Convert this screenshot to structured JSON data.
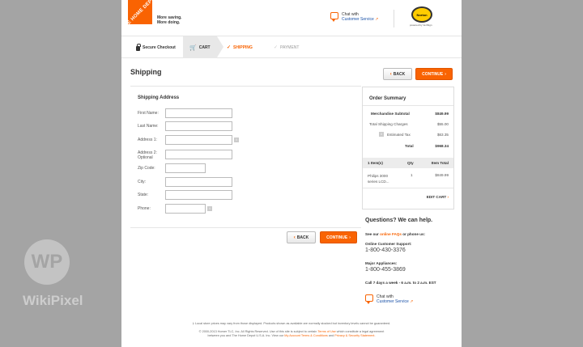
{
  "brand": {
    "logo_text": "THE HOME DEPOT",
    "tagline_1": "More saving.",
    "tagline_2": "More doing."
  },
  "header": {
    "chat_with": "Chat with",
    "customer_service": "Customer Service",
    "norton_label": "Norton",
    "norton_secured": "SECURED",
    "norton_powered": "powered by VeriSign"
  },
  "steps": {
    "secure": "Secure Checkout",
    "cart": "CART",
    "shipping": "SHIPPING",
    "payment": "PAYMENT"
  },
  "page": {
    "title": "Shipping",
    "back": "BACK",
    "continue": "CONTINUE"
  },
  "form": {
    "title": "Shipping Address",
    "first_name": "First Name:",
    "last_name": "Last Name:",
    "address1": "Address 1:",
    "address2": "Address 2:",
    "optional": "Optional",
    "zip": "Zip Code:",
    "city": "City:",
    "state": "State:",
    "phone": "Phone:"
  },
  "summary": {
    "title": "Order Summary",
    "subtotal_label": "Merchandise Subtotal",
    "subtotal": "$849.99",
    "shipping_label": "Total Shipping Charges",
    "shipping": "$55.00",
    "tax_label": "Estimated Tax",
    "tax": "$63.35",
    "total_label": "Total",
    "total": "$968.34",
    "col_items": "1  Item(s)",
    "col_qty": "Qty",
    "col_total": "Item Total",
    "item_name_1": "Philips 3000",
    "item_name_2": "series LCD...",
    "item_qty": "1",
    "item_total": "$849.99",
    "edit_cart": "EDIT CART"
  },
  "help": {
    "title": "Questions? We can help.",
    "see_our": "See our",
    "faq": "online FAQs",
    "or_phone": "or phone us:",
    "online_cs": "Online Customer Support:",
    "phone1": "1-800-430-3376",
    "major": "Major Appliances:",
    "phone2": "1-800-455-3869",
    "hours": "Call 7 days a week - 6 a.m. to 2 a.m. EST",
    "chat_with": "Chat with",
    "customer_service": "Customer Service"
  },
  "footer": {
    "line1": "‡ Local store prices may vary from those displayed. Products shown as available are normally stocked but inventory levels cannot be guaranteed.",
    "line2a": "© 2000-2013 Homer TLC, Inc. All Rights Reserved. Use of this site is subject to certain",
    "terms": "Terms of Use",
    "line2b": "which constitute a legal agreement",
    "line3a": "between you and The Home Depot U.S.A. Inc. View our",
    "account_terms": "My Account Terms & Conditions",
    "and": "and",
    "privacy": "Privacy & Security Statement."
  },
  "watermark": {
    "mark": "WP",
    "text": "WikiPixel"
  }
}
